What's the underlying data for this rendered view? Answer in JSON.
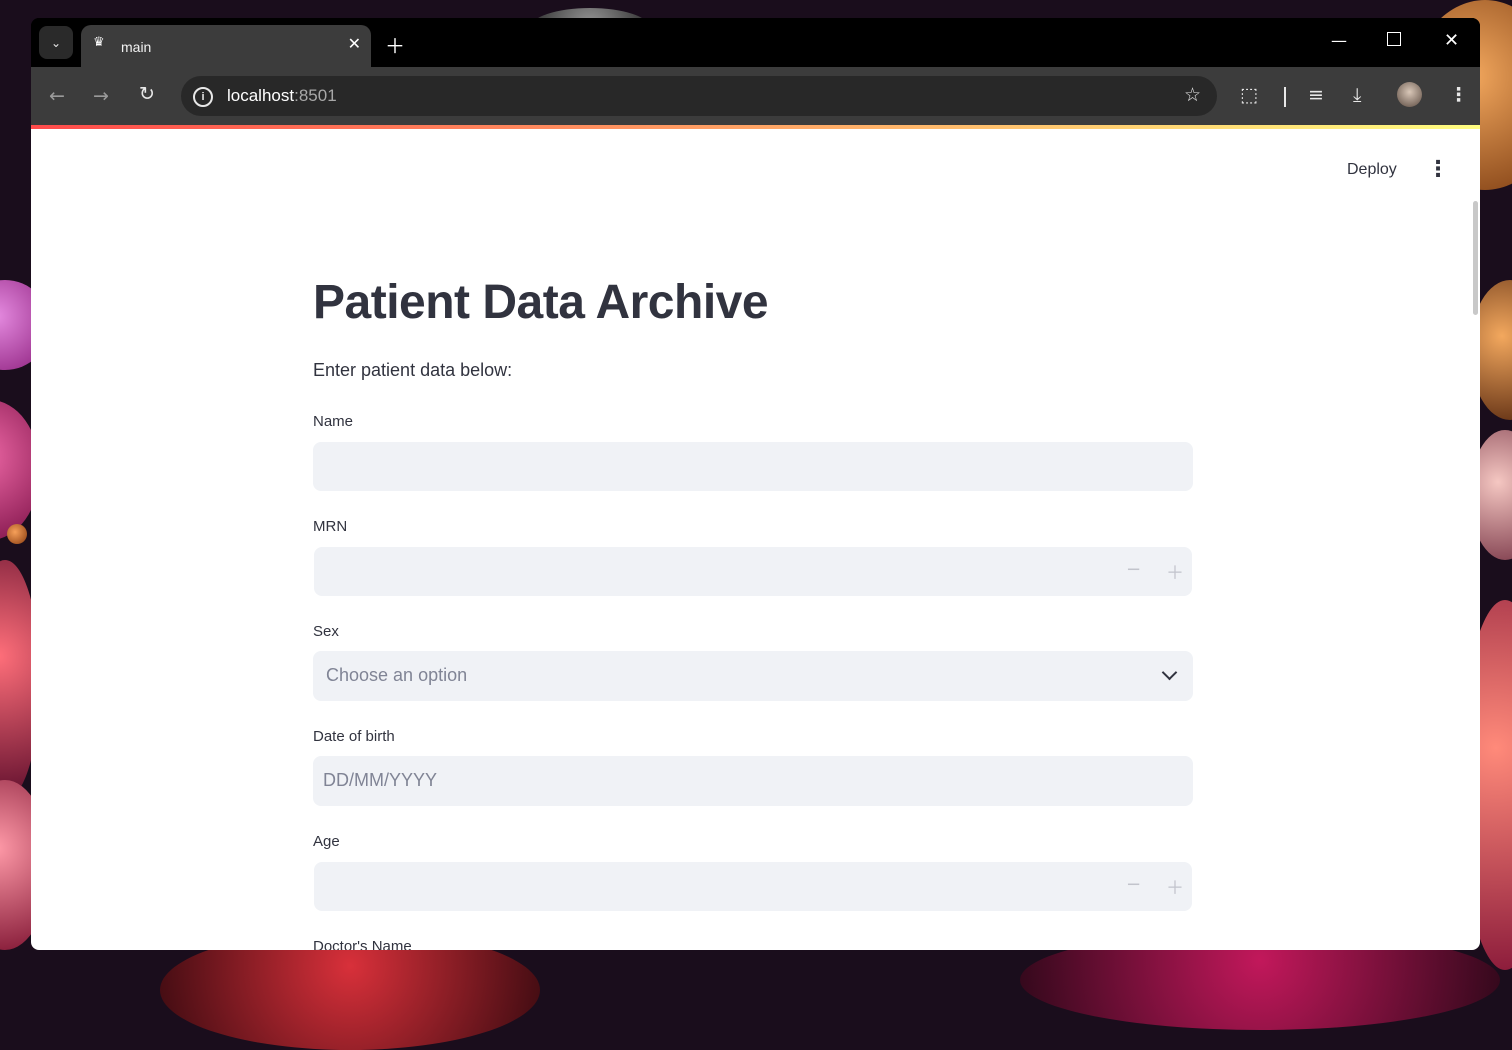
{
  "browser": {
    "tab_title": "main",
    "url_host": "localhost",
    "url_port": ":8501"
  },
  "app": {
    "deploy_label": "Deploy",
    "title": "Patient Data Archive",
    "intro": "Enter patient data below:"
  },
  "form": {
    "name": {
      "label": "Name",
      "value": ""
    },
    "mrn": {
      "label": "MRN",
      "value": ""
    },
    "sex": {
      "label": "Sex",
      "placeholder": "Choose an option"
    },
    "dob": {
      "label": "Date of birth",
      "placeholder": "DD/MM/YYYY"
    },
    "age": {
      "label": "Age",
      "value": ""
    },
    "doctor": {
      "label": "Doctor's Name"
    }
  },
  "colors": {
    "accent_gradient_start": "#ff4b4b",
    "accent_gradient_end": "#fffd80",
    "input_bg": "#f0f2f6",
    "text": "#31333f"
  }
}
